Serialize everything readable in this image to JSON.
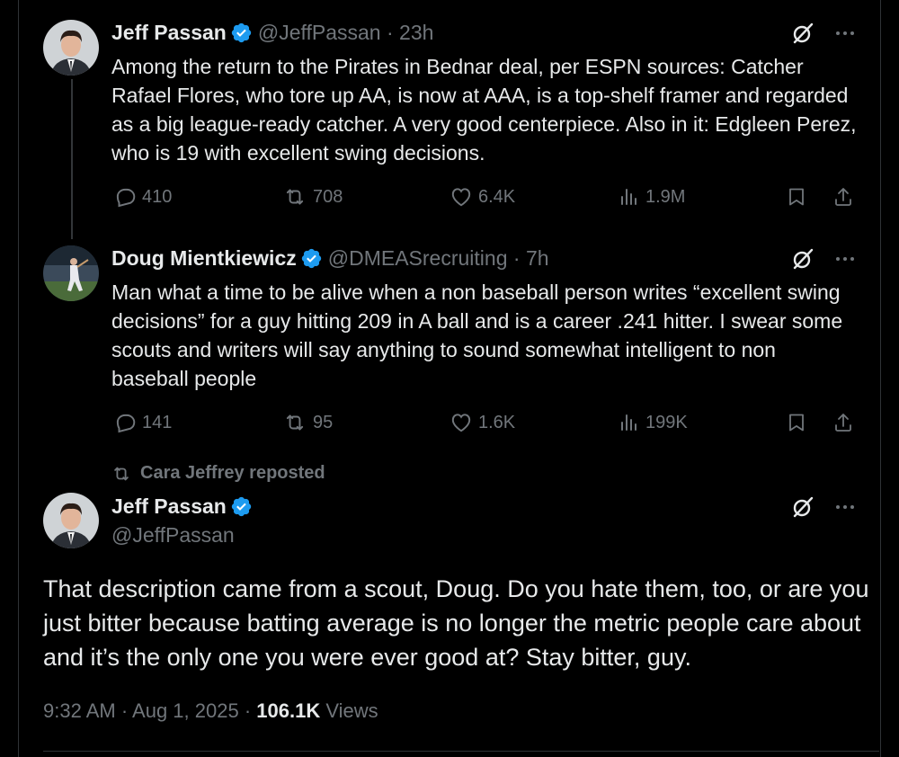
{
  "tweets": [
    {
      "author": "Jeff Passan",
      "handle": "@JeffPassan",
      "time": "23h",
      "text": "Among the return to the Pirates in Bednar deal, per ESPN sources: Catcher Rafael Flores, who tore up AA, is now at AAA, is a top-shelf framer and regarded as a big league-ready catcher. A very good centerpiece. Also in it: Edgleen Perez, who is 19 with excellent swing decisions.",
      "replies": "410",
      "reposts": "708",
      "likes": "6.4K",
      "views": "1.9M"
    },
    {
      "author": "Doug Mientkiewicz",
      "handle": "@DMEASrecruiting",
      "time": "7h",
      "text": "Man what a time to be alive when a non baseball person writes “excellent swing decisions” for a guy hitting 209 in A ball and is a career .241 hitter. I swear some scouts and writers will say anything to sound somewhat intelligent to non baseball people",
      "replies": "141",
      "reposts": "95",
      "likes": "1.6K",
      "views": "199K"
    }
  ],
  "main_tweet": {
    "repost_label": "Cara Jeffrey reposted",
    "author": "Jeff Passan",
    "handle": "@JeffPassan",
    "text": "That description came from a scout, Doug. Do you hate them, too, or are you just bitter because batting average is no longer the metric people care about and it’s the only one you were ever good at? Stay bitter, guy.",
    "timestamp": "9:32 AM · Aug 1, 2025 · ",
    "views_count": "106.1K",
    "views_label": " Views"
  },
  "separator": " · ",
  "colors": {
    "background": "#000000",
    "text": "#e7e9ea",
    "secondary": "#71767b",
    "verified": "#1d9bf0",
    "border": "#2f3336"
  },
  "icons": [
    "verified-badge-icon",
    "grok-icon",
    "more-icon",
    "reply-icon",
    "repost-icon",
    "like-icon",
    "views-icon",
    "bookmark-icon",
    "share-icon"
  ]
}
